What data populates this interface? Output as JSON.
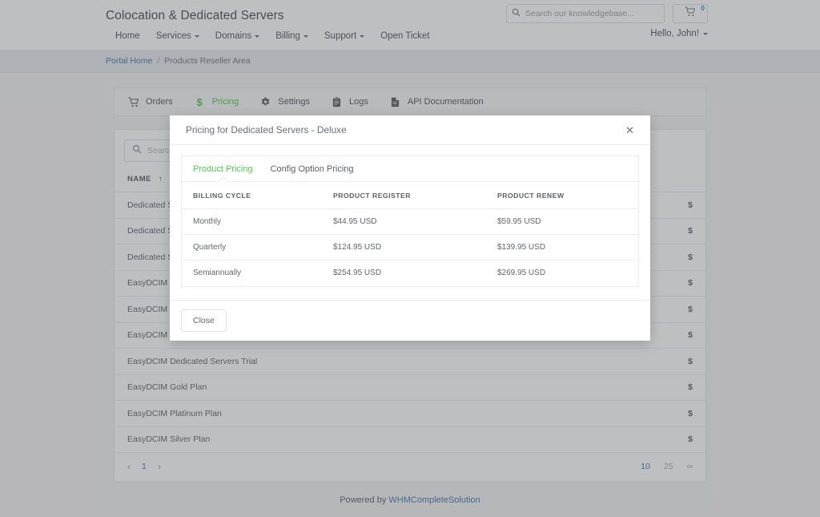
{
  "header": {
    "brand": "Colocation & Dedicated Servers",
    "nav": [
      {
        "label": "Home",
        "caret": false
      },
      {
        "label": "Services",
        "caret": true
      },
      {
        "label": "Domains",
        "caret": true
      },
      {
        "label": "Billing",
        "caret": true
      },
      {
        "label": "Support",
        "caret": true
      },
      {
        "label": "Open Ticket",
        "caret": false
      }
    ],
    "search_placeholder": "Search our knowledgebase...",
    "search_value": "",
    "cart_count": "0",
    "account_label": "Hello, John!"
  },
  "breadcrumb": {
    "home": "Portal Home",
    "separator": "/",
    "current": "Products Reseller Area"
  },
  "section_tabs": [
    {
      "label": "Orders",
      "icon": "cart-icon",
      "active": false
    },
    {
      "label": "Pricing",
      "icon": "dollar-icon",
      "active": true
    },
    {
      "label": "Settings",
      "icon": "gear-icon",
      "active": false
    },
    {
      "label": "Logs",
      "icon": "clipboard-icon",
      "active": false
    },
    {
      "label": "API Documentation",
      "icon": "file-icon",
      "active": false
    }
  ],
  "products": {
    "search_placeholder": "Search...",
    "search_value": "",
    "column_name": "NAME",
    "sort_indicator": "↑",
    "action_icon": "$",
    "rows": [
      "Dedicated Servers - Basic",
      "Dedicated Servers - Deluxe",
      "Dedicated Servers - Premium",
      "EasyDCIM Dedicated Servers Basic",
      "EasyDCIM Dedicated Servers Deluxe",
      "EasyDCIM Dedicated Servers Premium",
      "EasyDCIM Dedicated Servers Trial",
      "EasyDCIM Gold Plan",
      "EasyDCIM Platinum Plan",
      "EasyDCIM Silver Plan"
    ],
    "pagination": {
      "prev": "‹",
      "next": "›",
      "pages": [
        "1"
      ],
      "current_page": "1",
      "per_page_options": [
        "10",
        "25",
        "∞"
      ],
      "per_page_selected": "10"
    }
  },
  "footer": {
    "prefix": "Powered by ",
    "link": "WHMCompleteSolution"
  },
  "modal": {
    "title": "Pricing for Dedicated Servers - Deluxe",
    "close_icon": "✕",
    "tabs": [
      {
        "label": "Product Pricing",
        "active": true
      },
      {
        "label": "Config Option Pricing",
        "active": false
      }
    ],
    "table": {
      "headers": [
        "BILLING CYCLE",
        "PRODUCT REGISTER",
        "PRODUCT RENEW"
      ],
      "rows": [
        [
          "Monthly",
          "$44.95 USD",
          "$59.95 USD"
        ],
        [
          "Quarterly",
          "$124.95 USD",
          "$139.95 USD"
        ],
        [
          "Semiannually",
          "$254.95 USD",
          "$269.95 USD"
        ]
      ]
    },
    "close_button": "Close"
  },
  "colors": {
    "accent_green": "#5cc45c",
    "link_blue": "#4a7bb0",
    "teal_badge": "#2c9aa8"
  }
}
